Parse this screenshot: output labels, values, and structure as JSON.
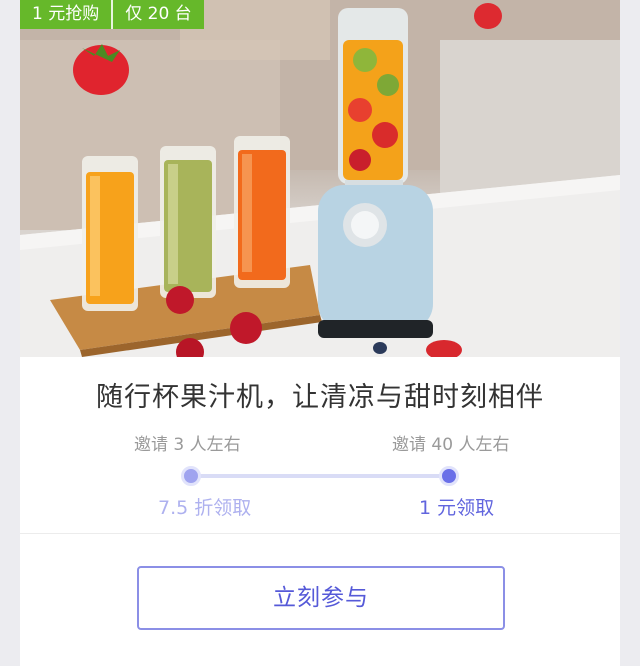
{
  "promo": {
    "price_label": "1 元抢购",
    "stock_label": "仅 20 台"
  },
  "product": {
    "title": "随行杯果汁机，让清凉与甜时刻相伴"
  },
  "steps": [
    {
      "invite": "邀请 3 人左右",
      "reward": "7.5 折领取"
    },
    {
      "invite": "邀请 40 人左右",
      "reward": "1 元领取"
    }
  ],
  "cta": {
    "label": "立刻参与"
  },
  "colors": {
    "accent": "#6165de",
    "promo_green": "#66b82a",
    "track": "#d9dcf6"
  }
}
